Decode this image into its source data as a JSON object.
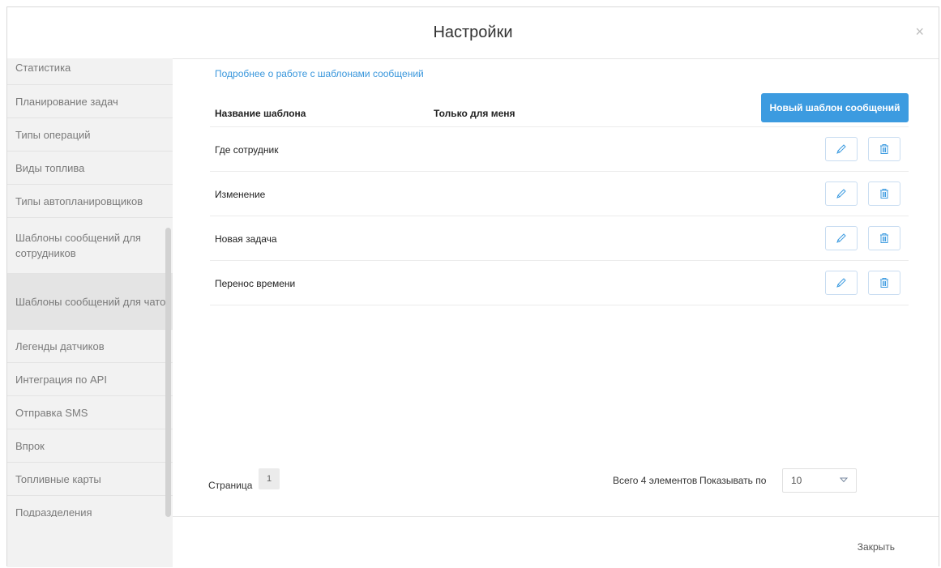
{
  "modal": {
    "title": "Настройки",
    "close_icon": "×"
  },
  "sidebar": {
    "items": [
      {
        "label": "Статистика"
      },
      {
        "label": "Планирование задач"
      },
      {
        "label": "Типы операций"
      },
      {
        "label": "Виды топлива"
      },
      {
        "label": "Типы автопланировщиков"
      },
      {
        "label": "Шаблоны сообщений для сотрудников"
      },
      {
        "label": "Шаблоны сообщений для чатов",
        "active": true
      },
      {
        "label": "Легенды датчиков"
      },
      {
        "label": "Интеграция по API"
      },
      {
        "label": "Отправка SMS"
      },
      {
        "label": "Впрок"
      },
      {
        "label": "Топливные карты"
      },
      {
        "label": "Подразделения"
      }
    ]
  },
  "content": {
    "help_link": "Подробнее о работе с шаблонами сообщений",
    "table": {
      "columns": {
        "name": "Название шаблона",
        "only_me": "Только для меня"
      },
      "new_button": "Новый шаблон сообщений",
      "rows": [
        {
          "name": "Где сотрудник"
        },
        {
          "name": "Изменение"
        },
        {
          "name": "Новая задача"
        },
        {
          "name": "Перенос времени"
        }
      ]
    },
    "pager": {
      "label": "Страница",
      "current_page": "1",
      "total": "Всего 4 элементов",
      "show_label": "Показывать по",
      "per_page": "10"
    }
  },
  "footer": {
    "close_label": "Закрыть"
  },
  "colors": {
    "accent": "#3c9be0",
    "link": "#3a97dc",
    "sidebar_bg": "#f2f2f2"
  }
}
